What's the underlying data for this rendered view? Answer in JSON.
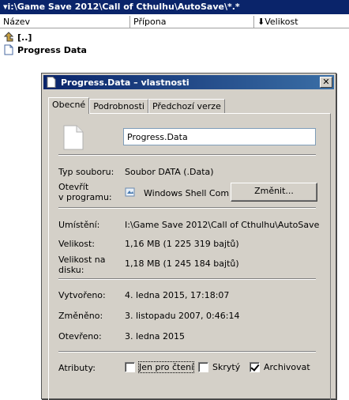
{
  "panel": {
    "path": "▾i:\\Game Save 2012\\Call of Cthulhu\\AutoSave\\*.*",
    "columns": {
      "name": "Název",
      "ext": "Přípona",
      "size": "⬇Velikost"
    },
    "rows": [
      {
        "name": "[..]",
        "icon": "up-folder-icon"
      },
      {
        "name": "Progress  Data",
        "icon": "file-icon"
      }
    ]
  },
  "dialog": {
    "title": "Progress.Data – vlastnosti",
    "close": "✕",
    "tabs": [
      "Obecné",
      "Podrobnosti",
      "Předchozí verze"
    ],
    "filename": "Progress.Data",
    "type_label": "Typ souboru:",
    "type_value": "Soubor DATA (.Data)",
    "opens_label_1": "Otevřít",
    "opens_label_2": "v programu:",
    "opens_value": "Windows Shell Commor",
    "change_button": "Změnit...",
    "location_label": "Umístění:",
    "location_value": "I:\\Game Save 2012\\Call of Cthulhu\\AutoSave",
    "size_label": "Velikost:",
    "size_value": "1,16 MB (1 225 319 bajtů)",
    "disk_size_label_1": "Velikost na",
    "disk_size_label_2": "disku:",
    "disk_size_value": "1,18 MB (1 245 184 bajtů)",
    "created_label": "Vytvořeno:",
    "created_value": "4. ledna 2015, 17:18:07",
    "modified_label": "Změněno:",
    "modified_value": "3. listopadu 2007, 0:46:14",
    "accessed_label": "Otevřeno:",
    "accessed_value": "3. ledna 2015",
    "attributes_label": "Atributy:",
    "attr_readonly": "Jen pro čtení",
    "attr_hidden": "Skrytý",
    "attr_archive": "Archivovat",
    "attr_readonly_checked": false,
    "attr_hidden_checked": false,
    "attr_archive_checked": true
  }
}
